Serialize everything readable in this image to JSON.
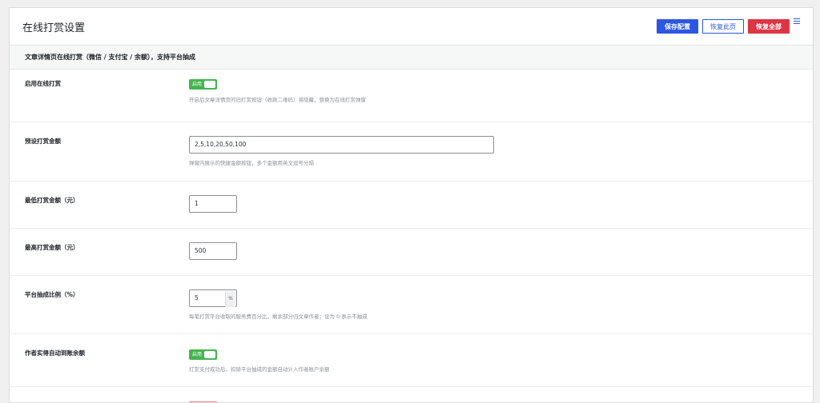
{
  "page": {
    "title": "在线打赏设置"
  },
  "toolbar": {
    "save_label": "保存配置",
    "restore_page_label": "恢复此页",
    "restore_all_label": "恢复全部",
    "menu_icon": "menu-icon"
  },
  "section": {
    "title": "文章详情页在线打赏（微信 / 支付宝 / 余额），支持平台抽成"
  },
  "fields": {
    "enable_reward": {
      "label": "启用在线打赏",
      "toggle_text": "启用",
      "enabled": true,
      "help": "开启后文章详情页的旧打赏按钮（收款二维码）将隐藏，替换为在线打赏弹窗"
    },
    "preset_amounts": {
      "label": "预设打赏金额",
      "value": "2,5,10,20,50,100",
      "help": "弹窗内展示的快捷金额按钮，多个金额用英文逗号分隔"
    },
    "min_amount": {
      "label": "最低打赏金额（元）",
      "value": "1"
    },
    "max_amount": {
      "label": "最高打赏金额（元）",
      "value": "500"
    },
    "platform_rate": {
      "label": "平台抽成比例（%）",
      "value": "5",
      "suffix": "%",
      "help": "每笔打赏平台收取的服务费百分比，剩余部分归文章作者；设为 0 表示不抽成"
    },
    "auto_credit": {
      "label": "作者实得自动到账余额",
      "toggle_text": "启用",
      "enabled": true,
      "help": "打赏支付成功后，扣除平台抽成的金额自动计入作者账户余额"
    }
  },
  "colors": {
    "primary": "#2c56e3",
    "danger": "#dc3545",
    "toggle_on": "#46b450"
  }
}
